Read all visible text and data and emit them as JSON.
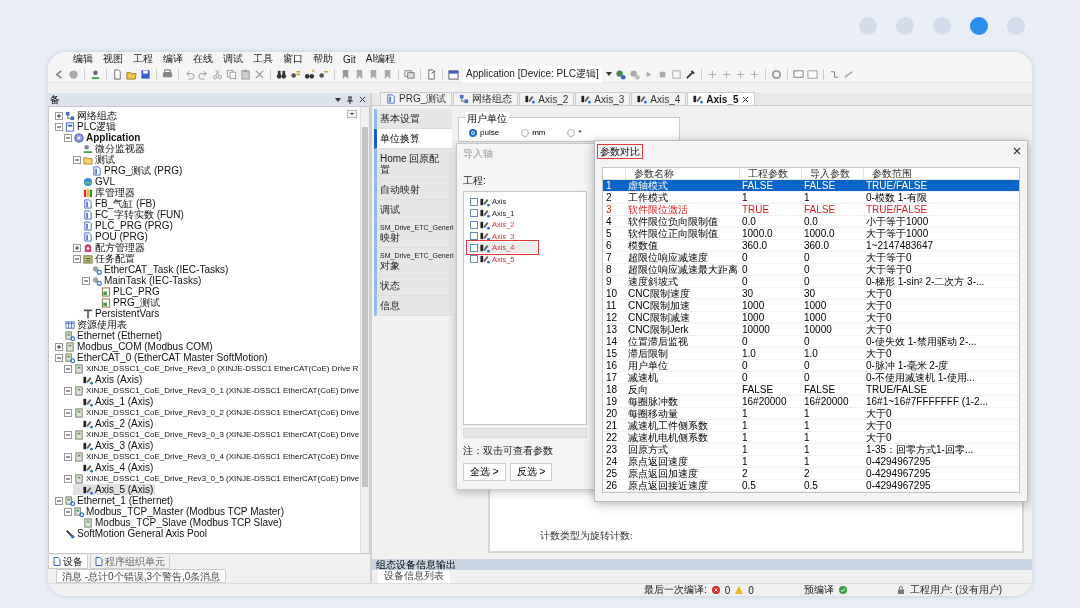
{
  "pager": [
    {
      "selected": false
    },
    {
      "selected": false
    },
    {
      "selected": false
    },
    {
      "selected": true
    },
    {
      "selected": false
    }
  ],
  "menu": [
    "编辑",
    "视图",
    "工程",
    "编译",
    "在线",
    "调试",
    "工具",
    "窗口",
    "帮助",
    "Git",
    "AI编程"
  ],
  "toolbar": {
    "application": "Application [Device: PLC逻辑]"
  },
  "devices_panel": {
    "title": "备",
    "tree": [
      {
        "label": "网络组态",
        "kind": "network",
        "expanded": false,
        "selected": false
      },
      {
        "label": "PLC逻辑",
        "kind": "plc",
        "expanded": true,
        "selected": false,
        "children": [
          {
            "label": "Application",
            "kind": "app",
            "expanded": true,
            "selected": false,
            "children": [
              {
                "label": "微分监视器",
                "kind": "monitor",
                "selected": false
              },
              {
                "label": "测试",
                "kind": "folder",
                "expanded": true,
                "selected": false,
                "children": [
                  {
                    "label": "PRG_测试 (PRG)",
                    "kind": "pou",
                    "selected": false
                  }
                ]
              },
              {
                "label": "GVL",
                "kind": "gvl",
                "selected": false
              },
              {
                "label": "库管理器",
                "kind": "library",
                "selected": false
              },
              {
                "label": "FB_气缸 (FB)",
                "kind": "pou",
                "selected": false
              },
              {
                "label": "FC_字转实数 (FUN)",
                "kind": "pou",
                "selected": false
              },
              {
                "label": "PLC_PRG (PRG)",
                "kind": "pou",
                "selected": false
              },
              {
                "label": "POU (PRG)",
                "kind": "pou",
                "selected": false
              },
              {
                "label": "配方管理器",
                "kind": "recipe",
                "expanded": false,
                "selected": false
              },
              {
                "label": "任务配置",
                "kind": "taskconfig",
                "expanded": true,
                "selected": false,
                "children": [
                  {
                    "label": "EtherCAT_Task (IEC-Tasks)",
                    "kind": "task",
                    "selected": false
                  },
                  {
                    "label": "MainTask (IEC-Tasks)",
                    "kind": "task",
                    "expanded": true,
                    "selected": false,
                    "children": [
                      {
                        "label": "PLC_PRG",
                        "kind": "call",
                        "selected": false
                      },
                      {
                        "label": "PRG_测试",
                        "kind": "call",
                        "selected": false
                      }
                    ]
                  }
                ]
              },
              {
                "label": "PersistentVars",
                "kind": "persistent",
                "selected": false
              }
            ]
          }
        ]
      },
      {
        "label": "资源使用表",
        "kind": "resource",
        "selected": false
      },
      {
        "label": "Ethernet (Ethernet)",
        "kind": "netdevice",
        "selected": false
      },
      {
        "label": "Modbus_COM (Modbus COM)",
        "kind": "device",
        "expanded": false,
        "selected": false
      },
      {
        "label": "EtherCAT_0 (EtherCAT Master SoftMotion)",
        "kind": "netdevice",
        "expanded": true,
        "selected": false,
        "children": [
          {
            "label": "XINJE_DSSC1_CoE_Drive_Rev3_0 (XINJE-DSSC1 EtherCAT(CoE) Drive R",
            "kind": "drive",
            "expanded": true,
            "selected": false,
            "children": [
              {
                "label": "Axis (Axis)",
                "kind": "axis",
                "selected": false
              }
            ]
          },
          {
            "label": "XINJE_DSSC1_CoE_Drive_Rev3_0_1 (XINJE-DSSC1 EtherCAT(CoE) Drive",
            "kind": "drive",
            "expanded": true,
            "selected": false,
            "children": [
              {
                "label": "Axis_1 (Axis)",
                "kind": "axis",
                "selected": false
              }
            ]
          },
          {
            "label": "XINJE_DSSC1_CoE_Drive_Rev3_0_2 (XINJE-DSSC1 EtherCAT(CoE) Drive",
            "kind": "drive",
            "expanded": true,
            "selected": false,
            "children": [
              {
                "label": "Axis_2 (Axis)",
                "kind": "axis",
                "selected": false
              }
            ]
          },
          {
            "label": "XINJE_DSSC1_CoE_Drive_Rev3_0_3 (XINJE-DSSC1 EtherCAT(CoE) Drive",
            "kind": "drive",
            "expanded": true,
            "selected": false,
            "children": [
              {
                "label": "Axis_3 (Axis)",
                "kind": "axis",
                "selected": false
              }
            ]
          },
          {
            "label": "XINJE_DSSC1_CoE_Drive_Rev3_0_4 (XINJE-DSSC1 EtherCAT(CoE) Drive",
            "kind": "drive",
            "expanded": true,
            "selected": false,
            "children": [
              {
                "label": "Axis_4 (Axis)",
                "kind": "axis",
                "selected": false
              }
            ]
          },
          {
            "label": "XINJE_DSSC1_CoE_Drive_Rev3_0_5 (XINJE-DSSC1 EtherCAT(CoE) Drive",
            "kind": "drive",
            "expanded": true,
            "selected": false,
            "children": [
              {
                "label": "Axis_5 (Axis)",
                "kind": "axis",
                "selected": true
              }
            ]
          }
        ]
      },
      {
        "label": "Ethernet_1 (Ethernet)",
        "kind": "netdevice",
        "expanded": true,
        "selected": false,
        "children": [
          {
            "label": "Modbus_TCP_Master (Modbus TCP Master)",
            "kind": "netdevice",
            "expanded": true,
            "selected": false,
            "children": [
              {
                "label": "Modbus_TCP_Slave (Modbus TCP Slave)",
                "kind": "device",
                "selected": false
              }
            ]
          }
        ]
      },
      {
        "label": "SoftMotion General Axis Pool",
        "kind": "pool",
        "selected": false
      }
    ],
    "tabs": [
      {
        "label": "设备",
        "selected": true
      },
      {
        "label": "程序组织单元",
        "selected": false
      }
    ],
    "messages": "消息 -总计0个错误,3个警告,0条消息"
  },
  "editor": {
    "tabs": [
      {
        "label": "PRG_测试",
        "kind": "pou",
        "selected": false
      },
      {
        "label": "网络组态",
        "kind": "network",
        "selected": false
      },
      {
        "label": "Axis_2",
        "kind": "axis",
        "selected": false
      },
      {
        "label": "Axis_3",
        "kind": "axis",
        "selected": false
      },
      {
        "label": "Axis_4",
        "kind": "axis",
        "selected": false
      },
      {
        "label": "Axis_5",
        "kind": "axis",
        "selected": true
      }
    ],
    "side_tabs": [
      {
        "lines": [
          "基本设置"
        ],
        "selected": false
      },
      {
        "lines": [
          "单位换算"
        ],
        "selected": true
      },
      {
        "lines": [
          "Home 回原配置"
        ],
        "selected": false
      },
      {
        "lines": [
          "自动映射"
        ],
        "selected": false
      },
      {
        "lines": [
          "调试"
        ],
        "selected": false
      },
      {
        "lines": [
          "SM_Drive_ETC_Generi",
          "映射"
        ],
        "selected": false
      },
      {
        "lines": [
          "SM_Drive_ETC_Generi",
          "对象"
        ],
        "selected": false
      },
      {
        "lines": [
          "状态"
        ],
        "selected": false
      },
      {
        "lines": [
          "信息"
        ],
        "selected": false
      }
    ],
    "unit_group": {
      "title": "用户单位",
      "options": [
        {
          "label": "pulse",
          "selected": true
        },
        {
          "label": "mm",
          "selected": false
        },
        {
          "label": "*",
          "selected": false
        }
      ]
    },
    "note": "计数类型为旋转计数:",
    "output": {
      "title": "组态设备信息输出",
      "tab": "设备信息列表"
    }
  },
  "import_dialog": {
    "title": "导入轴",
    "label": "工程:",
    "items": [
      {
        "label": "Axis",
        "checked": false,
        "differs": false,
        "marked": false
      },
      {
        "label": "Axis_1",
        "checked": false,
        "differs": false,
        "marked": false
      },
      {
        "label": "Axis_2",
        "checked": false,
        "differs": true,
        "marked": false
      },
      {
        "label": "Axis_3",
        "checked": false,
        "differs": true,
        "marked": false
      },
      {
        "label": "Axis_4",
        "checked": false,
        "differs": true,
        "marked": true
      },
      {
        "label": "Axis_5",
        "checked": false,
        "differs": true,
        "marked": false
      }
    ],
    "note": "注：双击可查看参数",
    "buttons": [
      "全选 >",
      "反选 >"
    ]
  },
  "compare_dialog": {
    "title": "参数对比",
    "title_marked": true,
    "columns": [
      "",
      "参数名称",
      "工程参数",
      "导入参数",
      "参数范围"
    ],
    "rows": [
      {
        "cells": [
          "1",
          "虚轴模式",
          "FALSE",
          "FALSE",
          "TRUE/FALSE"
        ],
        "selected": true,
        "differs": false
      },
      {
        "cells": [
          "2",
          "工作模式",
          "1",
          "1",
          "0-模数 1-有限"
        ],
        "selected": false,
        "differs": false
      },
      {
        "cells": [
          "3",
          "软件限位激活",
          "TRUE",
          "FALSE",
          "TRUE/FALSE"
        ],
        "selected": false,
        "differs": true
      },
      {
        "cells": [
          "4",
          "软件限位负向限制值",
          "0.0",
          "0.0",
          "小于等于1000"
        ],
        "selected": false,
        "differs": false
      },
      {
        "cells": [
          "5",
          "软件限位正向限制值",
          "1000.0",
          "1000.0",
          "大于等于1000"
        ],
        "selected": false,
        "differs": false
      },
      {
        "cells": [
          "6",
          "模数值",
          "360.0",
          "360.0",
          "1~2147483647"
        ],
        "selected": false,
        "differs": false
      },
      {
        "cells": [
          "7",
          "超限位响应减速度",
          "0",
          "0",
          "大于等于0"
        ],
        "selected": false,
        "differs": false
      },
      {
        "cells": [
          "8",
          "超限位响应减速最大距离",
          "0",
          "0",
          "大于等于0"
        ],
        "selected": false,
        "differs": false
      },
      {
        "cells": [
          "9",
          "速度斜坡式",
          "0",
          "0",
          "0-梯形 1-sin² 2-二次方 3-..."
        ],
        "selected": false,
        "differs": false
      },
      {
        "cells": [
          "10",
          "CNC限制速度",
          "30",
          "30",
          "大于0"
        ],
        "selected": false,
        "differs": false
      },
      {
        "cells": [
          "11",
          "CNC限制加速",
          "1000",
          "1000",
          "大于0"
        ],
        "selected": false,
        "differs": false
      },
      {
        "cells": [
          "12",
          "CNC限制减速",
          "1000",
          "1000",
          "大于0"
        ],
        "selected": false,
        "differs": false
      },
      {
        "cells": [
          "13",
          "CNC限制Jerk",
          "10000",
          "10000",
          "大于0"
        ],
        "selected": false,
        "differs": false
      },
      {
        "cells": [
          "14",
          "位置滞后监视",
          "0",
          "0",
          "0-使失效 1-禁用驱动 2-..."
        ],
        "selected": false,
        "differs": false
      },
      {
        "cells": [
          "15",
          "滞后限制",
          "1.0",
          "1.0",
          "大于0"
        ],
        "selected": false,
        "differs": false
      },
      {
        "cells": [
          "16",
          "用户单位",
          "0",
          "0",
          "0-脉冲 1-毫米 2-度"
        ],
        "selected": false,
        "differs": false
      },
      {
        "cells": [
          "17",
          "减速机",
          "0",
          "0",
          "0-不使用减速机 1-使用..."
        ],
        "selected": false,
        "differs": false
      },
      {
        "cells": [
          "18",
          "反向",
          "FALSE",
          "FALSE",
          "TRUE/FALSE"
        ],
        "selected": false,
        "differs": false
      },
      {
        "cells": [
          "19",
          "每圈脉冲数",
          "16#20000",
          "16#20000",
          "16#1~16#7FFFFFFF (1-2..."
        ],
        "selected": false,
        "differs": false
      },
      {
        "cells": [
          "20",
          "每圈移动量",
          "1",
          "1",
          "大于0"
        ],
        "selected": false,
        "differs": false
      },
      {
        "cells": [
          "21",
          "减速机工件侧系数",
          "1",
          "1",
          "大于0"
        ],
        "selected": false,
        "differs": false
      },
      {
        "cells": [
          "22",
          "减速机电机侧系数",
          "1",
          "1",
          "大于0"
        ],
        "selected": false,
        "differs": false
      },
      {
        "cells": [
          "23",
          "回原方式",
          "1",
          "1",
          "1-35：回零方式1-回零..."
        ],
        "selected": false,
        "differs": false
      },
      {
        "cells": [
          "24",
          "原点返回速度",
          "1",
          "1",
          "0-4294967295"
        ],
        "selected": false,
        "differs": false
      },
      {
        "cells": [
          "25",
          "原点返回加速度",
          "2",
          "2",
          "0-4294967295"
        ],
        "selected": false,
        "differs": false
      },
      {
        "cells": [
          "26",
          "原点返回接近速度",
          "0.5",
          "0.5",
          "0-4294967295"
        ],
        "selected": false,
        "differs": false
      }
    ]
  },
  "status_bar": {
    "last_build": "最后一次编译:",
    "errors": "0",
    "warnings": "0",
    "precompile": "预编译",
    "user": "工程用户: (没有用户)"
  }
}
